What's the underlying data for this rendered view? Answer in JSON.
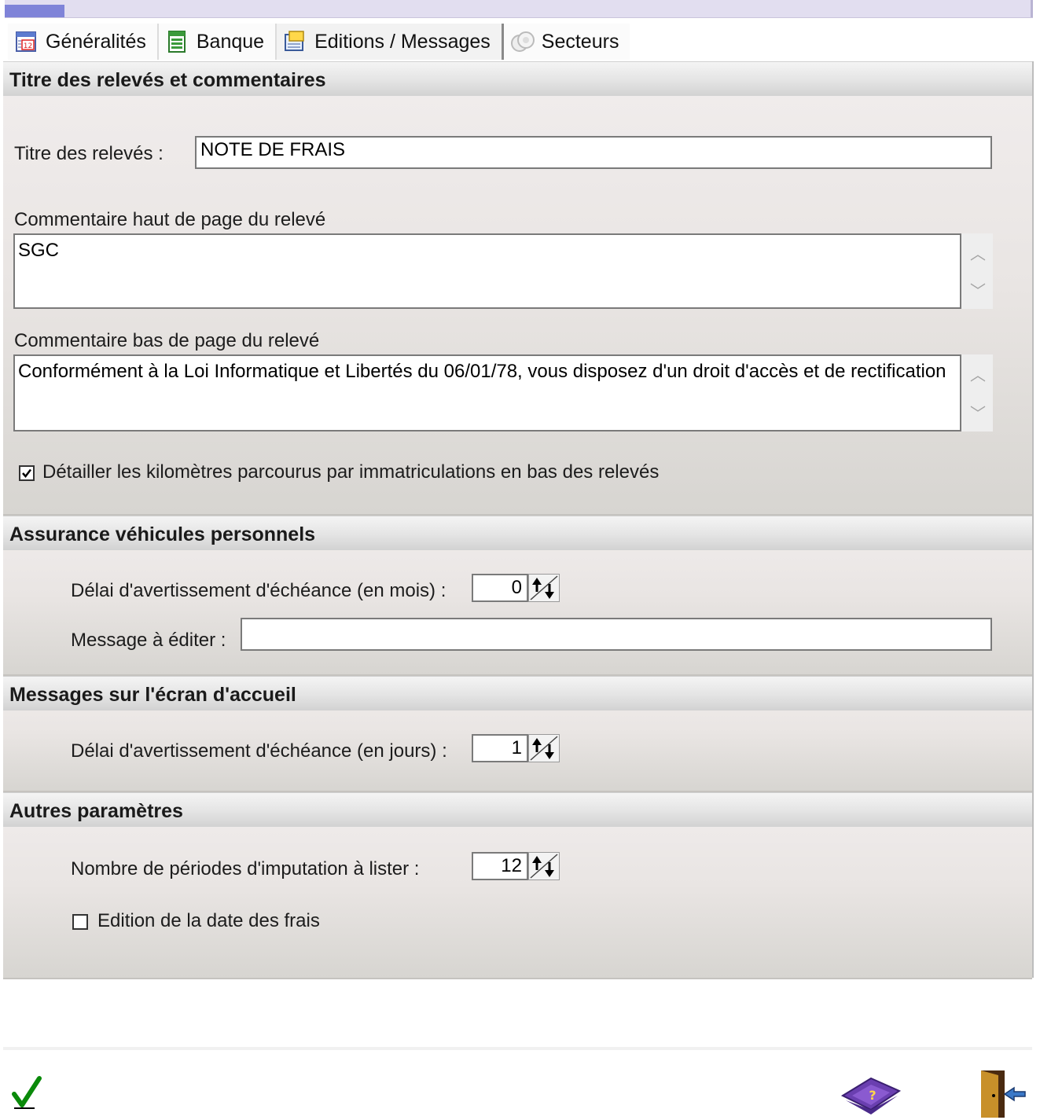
{
  "tabs": [
    {
      "label": "Généralités",
      "icon": "calendar-icon",
      "active": false
    },
    {
      "label": "Banque",
      "icon": "ledger-icon",
      "active": false
    },
    {
      "label": "Editions / Messages",
      "icon": "message-icon",
      "active": true
    },
    {
      "label": "Secteurs",
      "icon": "sectors-icon",
      "active": false
    }
  ],
  "section1": {
    "title": "Titre des relevés et commentaires",
    "titre_label": "Titre des relevés :",
    "titre_value": "NOTE DE FRAIS",
    "haut_label": "Commentaire haut de page du relevé",
    "haut_value": "SGC",
    "bas_label": "Commentaire bas de page du relevé",
    "bas_value": "Conformément à la Loi Informatique et Libertés du 06/01/78, vous disposez d'un droit d'accès et de rectification",
    "detail_label": "Détailler les kilomètres parcourus par immatriculations en bas des relevés",
    "detail_checked": true
  },
  "section2": {
    "title": "Assurance véhicules personnels",
    "delai_label": "Délai d'avertissement d'échéance (en mois)  :",
    "delai_value": "0",
    "message_label": "Message à éditer :",
    "message_value": ""
  },
  "section3": {
    "title": "Messages sur l'écran d'accueil",
    "delai_label": "Délai d'avertissement d'échéance (en jours)  :",
    "delai_value": "1"
  },
  "section4": {
    "title": "Autres paramètres",
    "periodes_label": "Nombre de périodes d'imputation à lister :",
    "periodes_value": "12",
    "edition_label": "Edition de la date des frais",
    "edition_checked": false
  },
  "footer": {
    "validate_icon": "checkmark-icon",
    "help_icon": "help-book-icon",
    "exit_icon": "exit-door-icon"
  }
}
